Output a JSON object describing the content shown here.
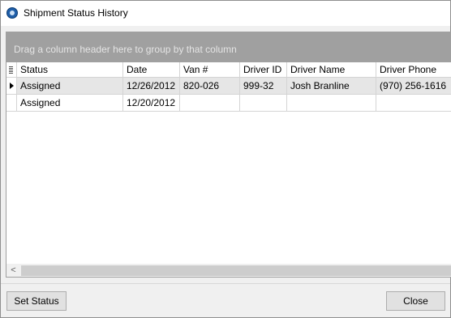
{
  "window": {
    "title": "Shipment Status History"
  },
  "grid": {
    "group_panel_text": "Drag a column header here to group by that column",
    "columns": [
      "Status",
      "Date",
      "Van #",
      "Driver ID",
      "Driver Name",
      "Driver Phone"
    ],
    "rows": [
      [
        "Assigned",
        "12/26/2012",
        "820-026",
        "999-32",
        "Josh Branline",
        "(970) 256-1616"
      ],
      [
        "Assigned",
        "12/20/2012",
        "",
        "",
        "",
        ""
      ]
    ],
    "selected_row_index": 0,
    "scroll_left_glyph": "<"
  },
  "footer": {
    "set_status_label": "Set Status",
    "close_label": "Close"
  },
  "colors": {
    "group_panel_bg": "#a0a0a0",
    "selected_row_bg": "#e6e6e6",
    "app_icon": "#1f5ea8"
  },
  "icons": {
    "app": "app-logo-icon",
    "column_chooser": "column-chooser-icon",
    "row_indicator": "row-pointer-icon"
  }
}
